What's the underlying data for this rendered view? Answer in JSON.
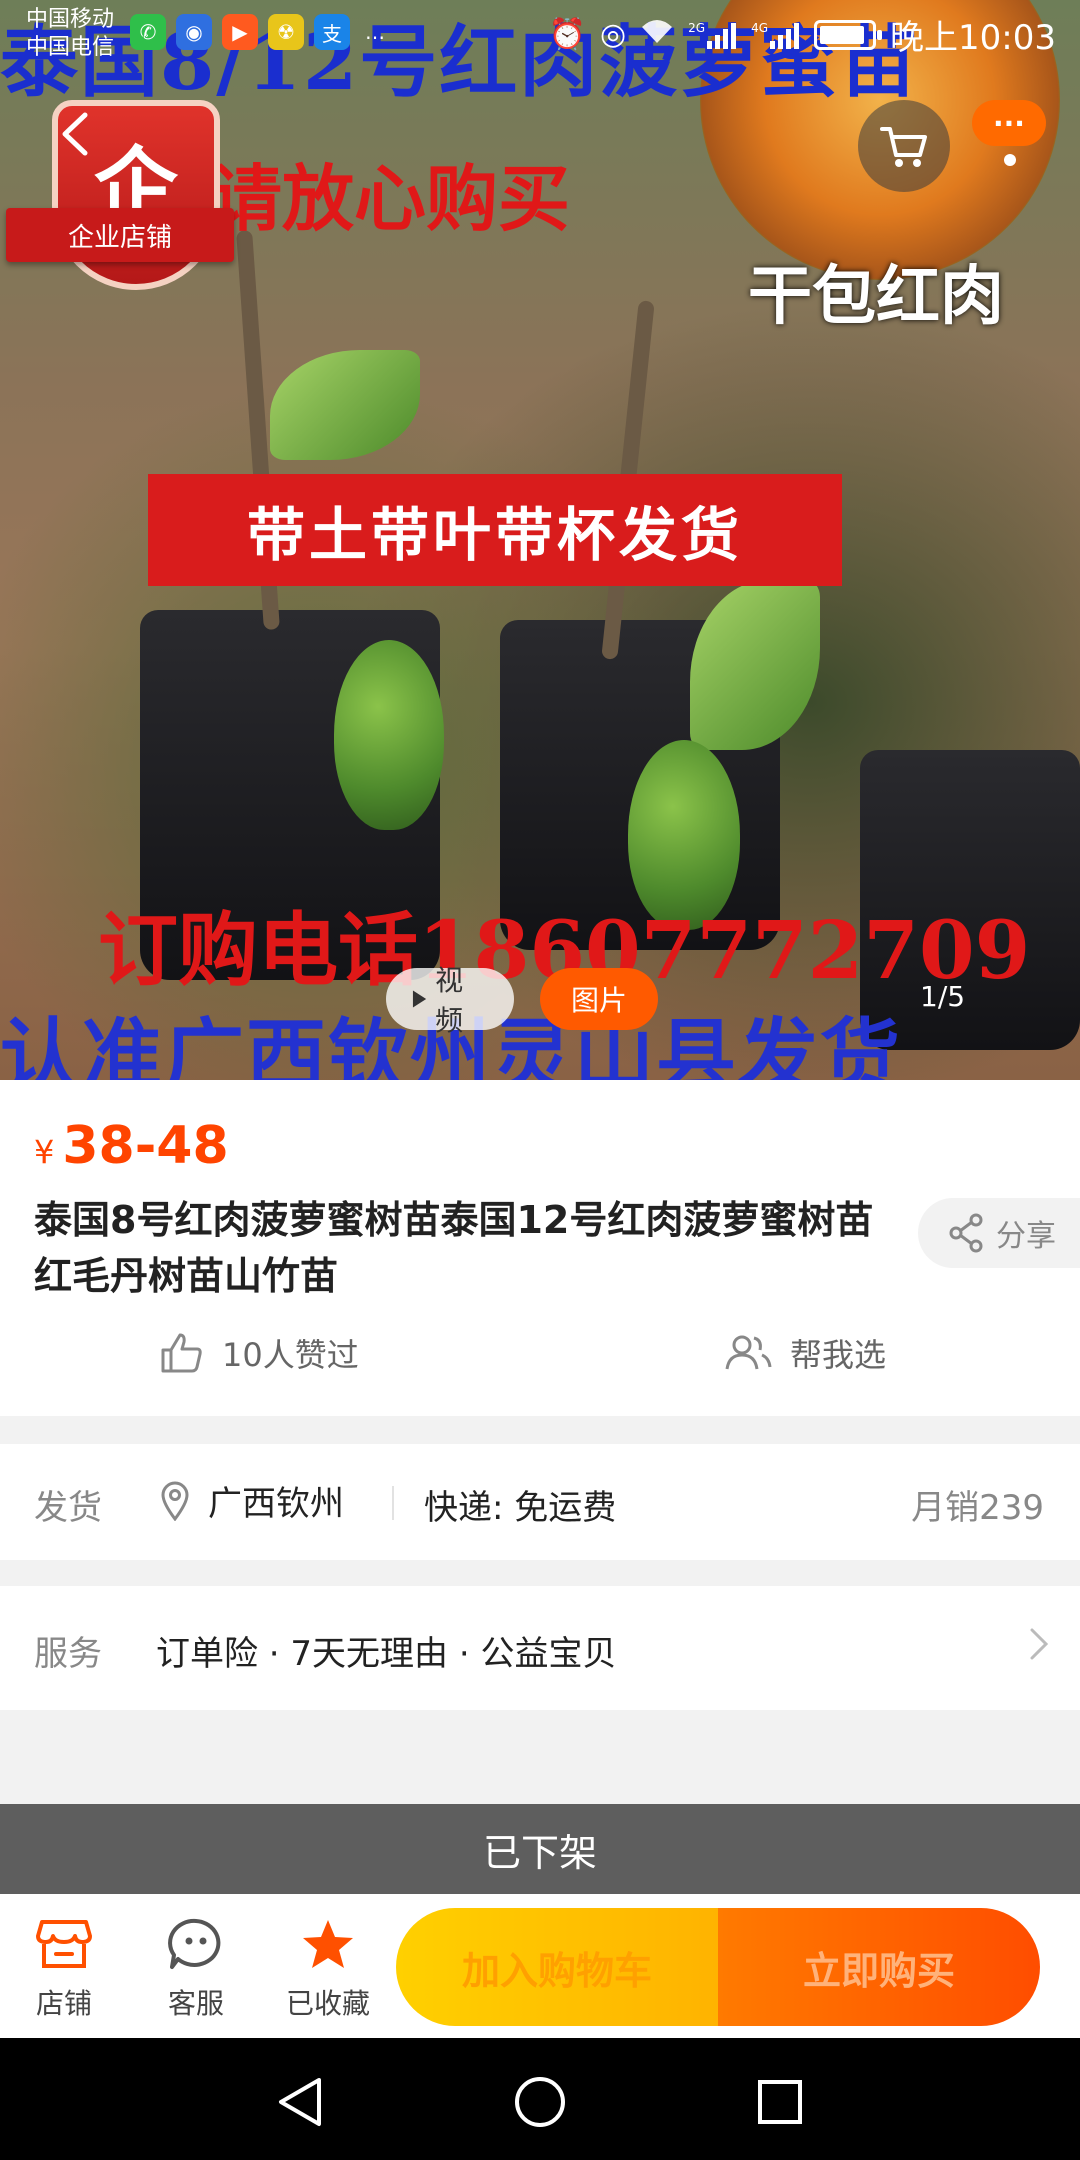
{
  "status_bar": {
    "carrier_1": "中国移动",
    "carrier_2": "中国电信",
    "network_1": "2G",
    "network_2": "4G",
    "time": "晚上10:03",
    "more": "…"
  },
  "hero": {
    "overlay_top": "泰国8/12号红肉菠萝蜜苗",
    "overlay_assure": "请放心购买",
    "overlay_flesh": "干包红肉",
    "overlay_banner": "带土带叶带杯发货",
    "overlay_phone": "订购电话18607772709",
    "overlay_location": "认准广西钦州灵山县发货",
    "shop_badge_mark": "企",
    "shop_badge_label": "企业店铺",
    "media_video": "视频",
    "media_photo": "图片",
    "counter": "1/5",
    "more_bubble": "···"
  },
  "product": {
    "currency": "¥",
    "price": "38-48",
    "title": "泰国8号红肉菠萝蜜树苗泰国12号红肉菠萝蜜树苗红毛丹树苗山竹苗",
    "share": "分享",
    "likes": "10人赞过",
    "help_choose": "帮我选"
  },
  "delivery": {
    "label": "发货",
    "location": "广西钦州",
    "express": "快递: 免运费",
    "monthly_sales": "月销239"
  },
  "service": {
    "label": "服务",
    "items": "订单险 · 7天无理由 · 公益宝贝"
  },
  "status_notice": "已下架",
  "action_bar": {
    "shop": "店铺",
    "customer_service": "客服",
    "favorited": "已收藏",
    "add_to_cart": "加入购物车",
    "buy_now": "立即购买"
  },
  "colors": {
    "accent": "#ff5000",
    "price": "#ff4400",
    "cart_button": "#ffc400",
    "buy_button": "#ff5a00"
  }
}
